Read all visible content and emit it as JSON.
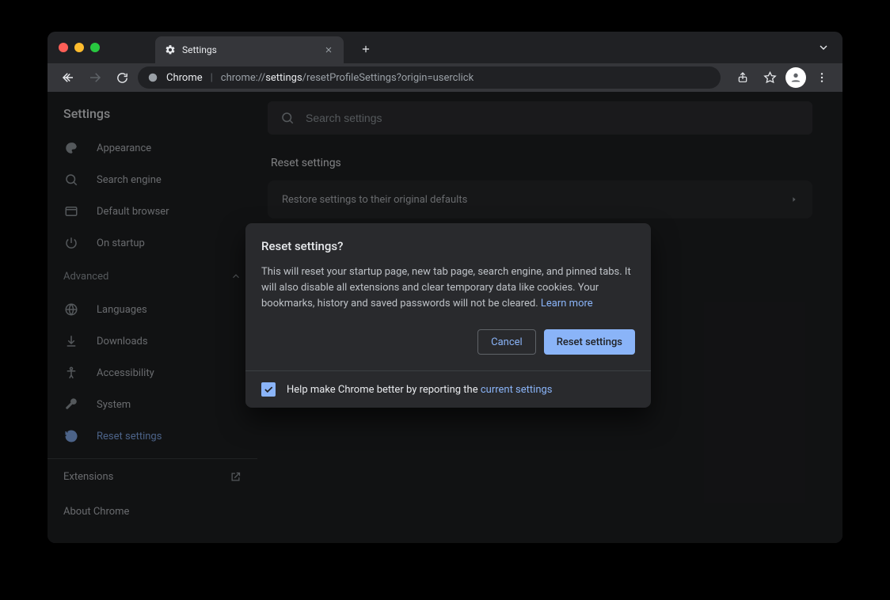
{
  "tab": {
    "title": "Settings"
  },
  "omnibox": {
    "app": "Chrome",
    "scheme": "chrome://",
    "path_bold": "settings",
    "path_rest": "/resetProfileSettings?origin=userclick"
  },
  "sidebar": {
    "title": "Settings",
    "items": [
      {
        "label": "Appearance",
        "icon": "palette"
      },
      {
        "label": "Search engine",
        "icon": "search"
      },
      {
        "label": "Default browser",
        "icon": "browser"
      },
      {
        "label": "On startup",
        "icon": "power"
      }
    ],
    "advanced_label": "Advanced",
    "adv_items": [
      {
        "label": "Languages",
        "icon": "globe"
      },
      {
        "label": "Downloads",
        "icon": "download"
      },
      {
        "label": "Accessibility",
        "icon": "accessibility"
      },
      {
        "label": "System",
        "icon": "wrench"
      },
      {
        "label": "Reset settings",
        "icon": "restore",
        "active": true
      }
    ],
    "extensions": "Extensions",
    "about": "About Chrome"
  },
  "search": {
    "placeholder": "Search settings"
  },
  "section": {
    "title": "Reset settings",
    "row": "Restore settings to their original defaults"
  },
  "dialog": {
    "title": "Reset settings?",
    "body": "This will reset your startup page, new tab page, search engine, and pinned tabs. It will also disable all extensions and clear temporary data like cookies. Your bookmarks, history and saved passwords will not be cleared.",
    "learn_more": "Learn more",
    "cancel": "Cancel",
    "confirm": "Reset settings",
    "help_prefix": "Help make Chrome better by reporting the ",
    "help_link": "current settings"
  },
  "colors": {
    "accent": "#8ab4f8",
    "surface": "#292a2d",
    "background": "#202124"
  }
}
